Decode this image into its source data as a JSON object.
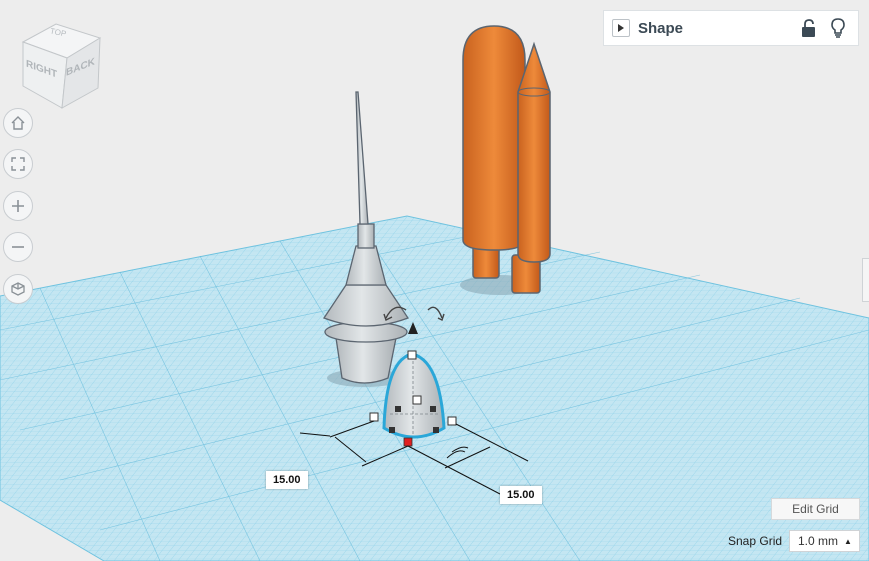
{
  "viewcube": {
    "face_right": "RIGHT",
    "face_back": "BACK",
    "face_top": "TOP"
  },
  "nav": [
    "home-icon",
    "fit-view-icon",
    "zoom-in-icon",
    "zoom-out-icon",
    "perspective-icon"
  ],
  "shape_panel": {
    "title": "Shape"
  },
  "dimensions": {
    "width_label": "15.00",
    "depth_label": "15.00"
  },
  "grid": {
    "edit_label": "Edit Grid",
    "snap_label": "Snap Grid",
    "snap_value": "1.0 mm"
  },
  "colors": {
    "workplane": "#bfe4f1",
    "grid_line": "#74c6e2",
    "tank_orange": "#e5762a",
    "tower_gray": "#c9ced2",
    "selection": "#2aa7d8",
    "handle_red": "#e02020"
  }
}
